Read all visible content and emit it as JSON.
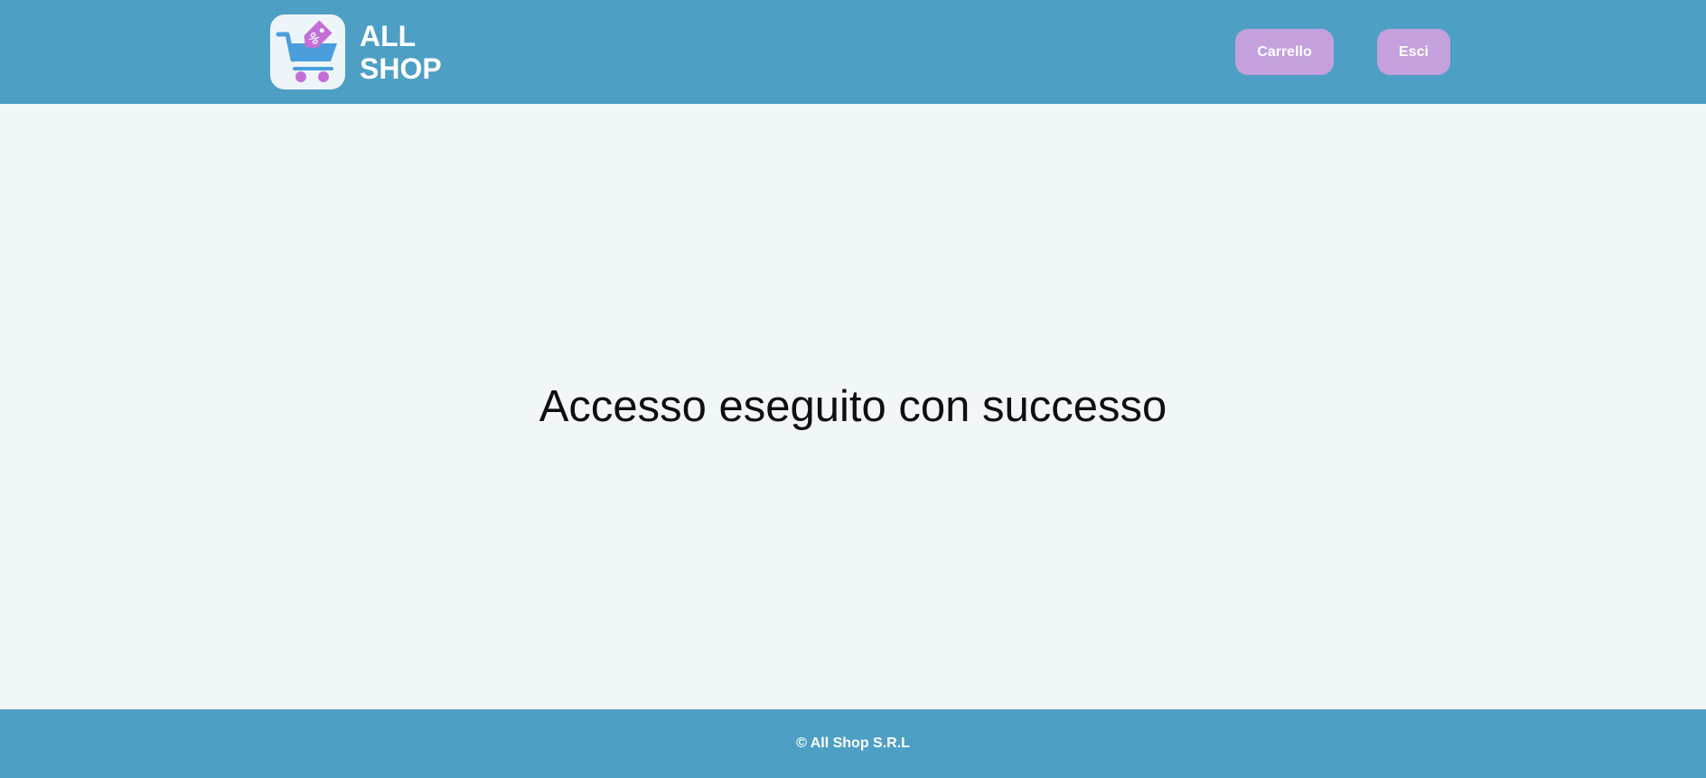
{
  "header": {
    "brand_line1": "ALL",
    "brand_line2": "SHOP",
    "logo_icon": "shopping-cart-with-discount-tag-icon",
    "buttons": {
      "cart_label": "Carrello",
      "logout_label": "Esci"
    }
  },
  "main": {
    "message": "Accesso eseguito con successo"
  },
  "footer": {
    "copyright": "© All Shop S.R.L"
  },
  "colors": {
    "header_bg": "#4e9fc4",
    "page_bg": "#f1f7f9",
    "button_bg": "#c4a0dc",
    "cart_blue": "#4a9edc",
    "tag_purple": "#c46fd8"
  }
}
